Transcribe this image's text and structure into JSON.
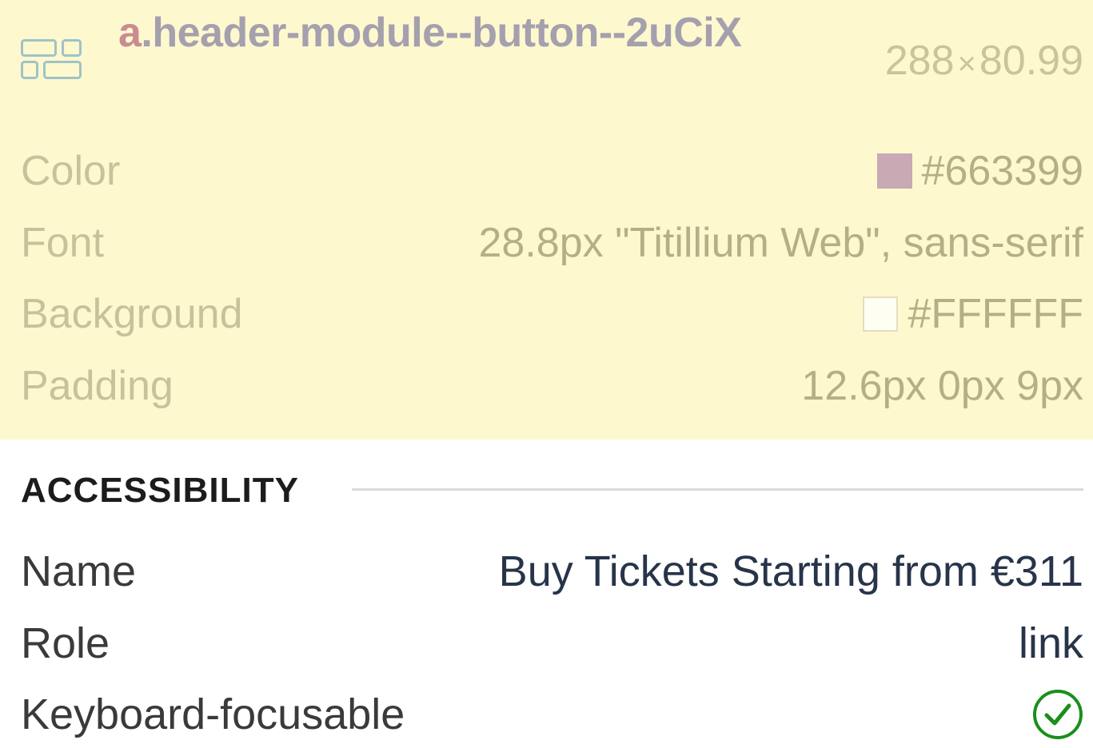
{
  "header": {
    "icon": "grid-layout-icon",
    "selector_tag": "a",
    "selector_class": ".header-module--button--2uCiX",
    "width": "288",
    "times": "×",
    "height": "80.99"
  },
  "properties": [
    {
      "label": "Color",
      "value": "#663399",
      "swatch": "#C8A9B4"
    },
    {
      "label": "Font",
      "value": "28.8px \"Titillium Web\", sans-serif"
    },
    {
      "label": "Background",
      "value": "#FFFFFF",
      "swatch": "#FFFFFF"
    },
    {
      "label": "Padding",
      "value": "12.6px 0px 9px"
    }
  ],
  "accessibility": {
    "title": "ACCESSIBILITY",
    "rows": [
      {
        "label": "Name",
        "value": "Buy Tickets Starting from €311"
      },
      {
        "label": "Role",
        "value": "link"
      },
      {
        "label": "Keyboard-focusable",
        "icon": "check-circle-icon",
        "icon_color": "#1A8F1A"
      }
    ]
  }
}
